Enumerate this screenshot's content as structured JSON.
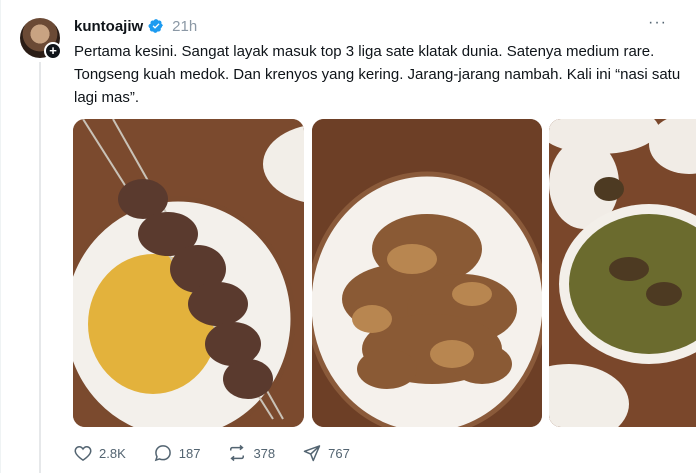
{
  "post": {
    "username": "kuntoajiw",
    "time": "21h",
    "text": "Pertama kesini. Sangat layak masuk top 3 liga sate klatak dunia. Satenya medium rare. Tongseng kuah medok. Dan krenyos yang kering. Jarang-jarang nambah. Kali ini “nasi satu lagi mas”.",
    "more": "···"
  },
  "actions": {
    "likes": "2.8K",
    "replies": "187",
    "reposts": "378",
    "shares": "767"
  },
  "colors": {
    "text": "#0f1419",
    "muted": "#536471",
    "verified": "#1d9bf0"
  },
  "icons": [
    "verified-icon",
    "more-icon",
    "heart-icon",
    "reply-icon",
    "repost-icon",
    "share-icon"
  ]
}
